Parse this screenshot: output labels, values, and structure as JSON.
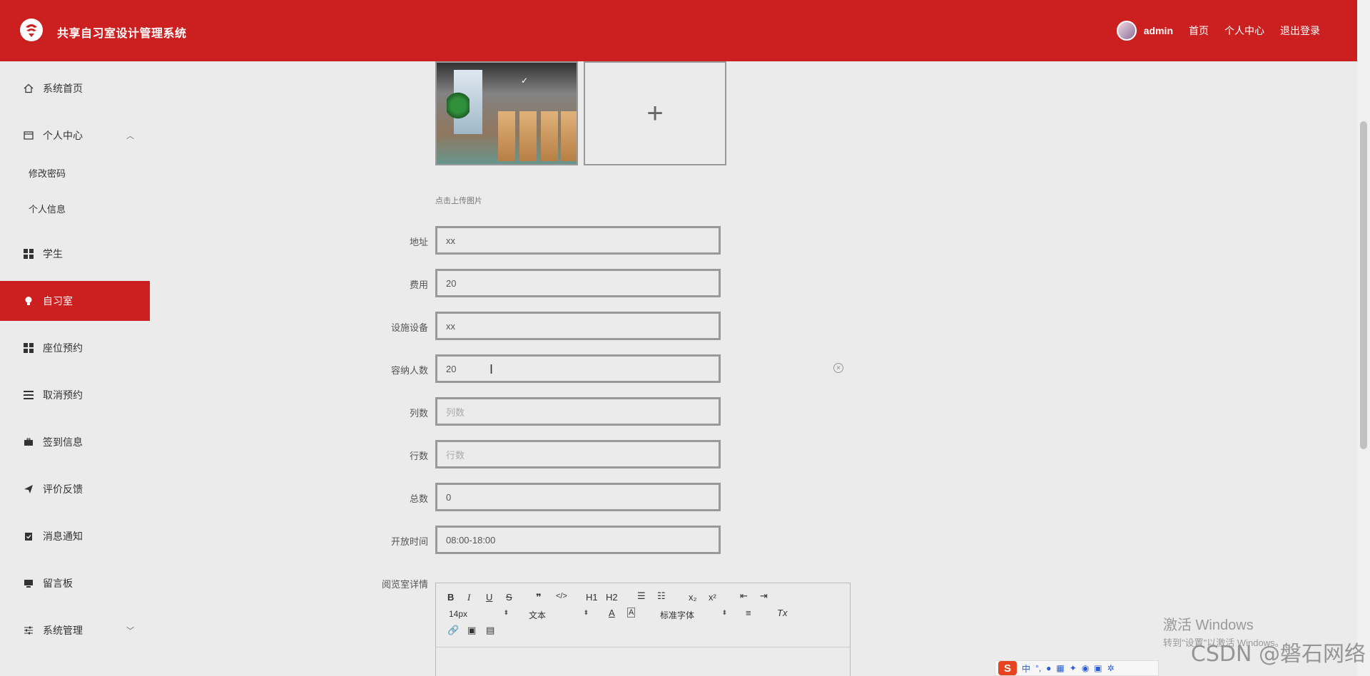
{
  "header": {
    "title": "共享自习室设计管理系统",
    "user": "admin",
    "links": [
      "首页",
      "个人中心",
      "退出登录"
    ]
  },
  "sidebar": {
    "items": [
      {
        "label": "系统首页",
        "icon": "home-icon"
      },
      {
        "label": "个人中心",
        "icon": "card-icon"
      },
      {
        "label": "修改密码"
      },
      {
        "label": "个人信息"
      },
      {
        "label": "学生",
        "icon": "grid-icon"
      },
      {
        "label": "自习室",
        "icon": "bulb-icon"
      },
      {
        "label": "座位预约",
        "icon": "grid-icon"
      },
      {
        "label": "取消预约",
        "icon": "list-icon"
      },
      {
        "label": "签到信息",
        "icon": "briefcase-icon"
      },
      {
        "label": "评价反馈",
        "icon": "send-icon"
      },
      {
        "label": "消息通知",
        "icon": "clipboard-icon"
      },
      {
        "label": "留言板",
        "icon": "monitor-icon"
      },
      {
        "label": "系统管理",
        "icon": "sliders-icon"
      }
    ]
  },
  "upload": {
    "plus": "+",
    "hint": "点击上传图片"
  },
  "form": {
    "fields": [
      {
        "label": "地址",
        "value": "xx",
        "placeholder": ""
      },
      {
        "label": "费用",
        "value": "20",
        "placeholder": ""
      },
      {
        "label": "设施设备",
        "value": "xx",
        "placeholder": ""
      },
      {
        "label": "容纳人数",
        "value": "20",
        "placeholder": ""
      },
      {
        "label": "列数",
        "value": "",
        "placeholder": "列数"
      },
      {
        "label": "行数",
        "value": "",
        "placeholder": "行数"
      },
      {
        "label": "总数",
        "value": "0",
        "placeholder": ""
      },
      {
        "label": "开放时间",
        "value": "08:00-18:00",
        "placeholder": ""
      }
    ],
    "details_label": "阅览室详情"
  },
  "editor": {
    "font_size": "14px",
    "text_type": "文本",
    "font_family": "标准字体",
    "buttons": {
      "bold": "B",
      "italic": "I",
      "underline": "U",
      "strike": "S",
      "quote": "❞",
      "code": "</>",
      "h1": "H1",
      "h2": "H2",
      "sub": "x₂",
      "sup": "x²",
      "clean": "Tx"
    }
  },
  "watermark": {
    "line1": "激活 Windows",
    "line2": "转到\"设置\"以激活 Windows。",
    "csdn": "CSDN @磐石网络"
  },
  "ime": {
    "logo": "S",
    "mode": "中"
  },
  "colors": {
    "primary": "#cc1f1f",
    "background": "#ebebeb"
  }
}
